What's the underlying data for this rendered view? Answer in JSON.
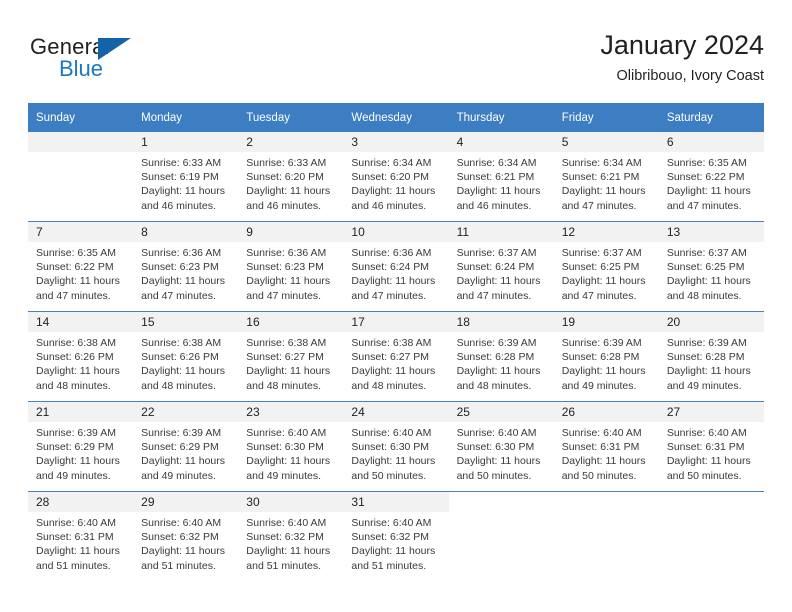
{
  "branding": {
    "name_top": "General",
    "name_bottom": "Blue",
    "triangle_color": "#1263a8",
    "blue_text_color": "#1b79c3"
  },
  "header": {
    "title": "January 2024",
    "subtitle": "Olibribouo, Ivory Coast"
  },
  "theme": {
    "header_row_bg": "#3c7ec1",
    "header_row_text": "#ffffff",
    "daynum_bg": "#f2f2f2",
    "row_divider": "#4a82bd",
    "body_text": "#3a3a3a"
  },
  "calendar": {
    "weekday_headers": [
      "Sunday",
      "Monday",
      "Tuesday",
      "Wednesday",
      "Thursday",
      "Friday",
      "Saturday"
    ],
    "weeks": [
      [
        {
          "day": "",
          "empty": true,
          "banded": true,
          "lines": []
        },
        {
          "day": "1",
          "lines": [
            "Sunrise: 6:33 AM",
            "Sunset: 6:19 PM",
            "Daylight: 11 hours",
            "and 46 minutes."
          ]
        },
        {
          "day": "2",
          "lines": [
            "Sunrise: 6:33 AM",
            "Sunset: 6:20 PM",
            "Daylight: 11 hours",
            "and 46 minutes."
          ]
        },
        {
          "day": "3",
          "lines": [
            "Sunrise: 6:34 AM",
            "Sunset: 6:20 PM",
            "Daylight: 11 hours",
            "and 46 minutes."
          ]
        },
        {
          "day": "4",
          "lines": [
            "Sunrise: 6:34 AM",
            "Sunset: 6:21 PM",
            "Daylight: 11 hours",
            "and 46 minutes."
          ]
        },
        {
          "day": "5",
          "lines": [
            "Sunrise: 6:34 AM",
            "Sunset: 6:21 PM",
            "Daylight: 11 hours",
            "and 47 minutes."
          ]
        },
        {
          "day": "6",
          "lines": [
            "Sunrise: 6:35 AM",
            "Sunset: 6:22 PM",
            "Daylight: 11 hours",
            "and 47 minutes."
          ]
        }
      ],
      [
        {
          "day": "7",
          "lines": [
            "Sunrise: 6:35 AM",
            "Sunset: 6:22 PM",
            "Daylight: 11 hours",
            "and 47 minutes."
          ]
        },
        {
          "day": "8",
          "lines": [
            "Sunrise: 6:36 AM",
            "Sunset: 6:23 PM",
            "Daylight: 11 hours",
            "and 47 minutes."
          ]
        },
        {
          "day": "9",
          "lines": [
            "Sunrise: 6:36 AM",
            "Sunset: 6:23 PM",
            "Daylight: 11 hours",
            "and 47 minutes."
          ]
        },
        {
          "day": "10",
          "lines": [
            "Sunrise: 6:36 AM",
            "Sunset: 6:24 PM",
            "Daylight: 11 hours",
            "and 47 minutes."
          ]
        },
        {
          "day": "11",
          "lines": [
            "Sunrise: 6:37 AM",
            "Sunset: 6:24 PM",
            "Daylight: 11 hours",
            "and 47 minutes."
          ]
        },
        {
          "day": "12",
          "lines": [
            "Sunrise: 6:37 AM",
            "Sunset: 6:25 PM",
            "Daylight: 11 hours",
            "and 47 minutes."
          ]
        },
        {
          "day": "13",
          "lines": [
            "Sunrise: 6:37 AM",
            "Sunset: 6:25 PM",
            "Daylight: 11 hours",
            "and 48 minutes."
          ]
        }
      ],
      [
        {
          "day": "14",
          "lines": [
            "Sunrise: 6:38 AM",
            "Sunset: 6:26 PM",
            "Daylight: 11 hours",
            "and 48 minutes."
          ]
        },
        {
          "day": "15",
          "lines": [
            "Sunrise: 6:38 AM",
            "Sunset: 6:26 PM",
            "Daylight: 11 hours",
            "and 48 minutes."
          ]
        },
        {
          "day": "16",
          "lines": [
            "Sunrise: 6:38 AM",
            "Sunset: 6:27 PM",
            "Daylight: 11 hours",
            "and 48 minutes."
          ]
        },
        {
          "day": "17",
          "lines": [
            "Sunrise: 6:38 AM",
            "Sunset: 6:27 PM",
            "Daylight: 11 hours",
            "and 48 minutes."
          ]
        },
        {
          "day": "18",
          "lines": [
            "Sunrise: 6:39 AM",
            "Sunset: 6:28 PM",
            "Daylight: 11 hours",
            "and 48 minutes."
          ]
        },
        {
          "day": "19",
          "lines": [
            "Sunrise: 6:39 AM",
            "Sunset: 6:28 PM",
            "Daylight: 11 hours",
            "and 49 minutes."
          ]
        },
        {
          "day": "20",
          "lines": [
            "Sunrise: 6:39 AM",
            "Sunset: 6:28 PM",
            "Daylight: 11 hours",
            "and 49 minutes."
          ]
        }
      ],
      [
        {
          "day": "21",
          "lines": [
            "Sunrise: 6:39 AM",
            "Sunset: 6:29 PM",
            "Daylight: 11 hours",
            "and 49 minutes."
          ]
        },
        {
          "day": "22",
          "lines": [
            "Sunrise: 6:39 AM",
            "Sunset: 6:29 PM",
            "Daylight: 11 hours",
            "and 49 minutes."
          ]
        },
        {
          "day": "23",
          "lines": [
            "Sunrise: 6:40 AM",
            "Sunset: 6:30 PM",
            "Daylight: 11 hours",
            "and 49 minutes."
          ]
        },
        {
          "day": "24",
          "lines": [
            "Sunrise: 6:40 AM",
            "Sunset: 6:30 PM",
            "Daylight: 11 hours",
            "and 50 minutes."
          ]
        },
        {
          "day": "25",
          "lines": [
            "Sunrise: 6:40 AM",
            "Sunset: 6:30 PM",
            "Daylight: 11 hours",
            "and 50 minutes."
          ]
        },
        {
          "day": "26",
          "lines": [
            "Sunrise: 6:40 AM",
            "Sunset: 6:31 PM",
            "Daylight: 11 hours",
            "and 50 minutes."
          ]
        },
        {
          "day": "27",
          "lines": [
            "Sunrise: 6:40 AM",
            "Sunset: 6:31 PM",
            "Daylight: 11 hours",
            "and 50 minutes."
          ]
        }
      ],
      [
        {
          "day": "28",
          "lines": [
            "Sunrise: 6:40 AM",
            "Sunset: 6:31 PM",
            "Daylight: 11 hours",
            "and 51 minutes."
          ]
        },
        {
          "day": "29",
          "lines": [
            "Sunrise: 6:40 AM",
            "Sunset: 6:32 PM",
            "Daylight: 11 hours",
            "and 51 minutes."
          ]
        },
        {
          "day": "30",
          "lines": [
            "Sunrise: 6:40 AM",
            "Sunset: 6:32 PM",
            "Daylight: 11 hours",
            "and 51 minutes."
          ]
        },
        {
          "day": "31",
          "lines": [
            "Sunrise: 6:40 AM",
            "Sunset: 6:32 PM",
            "Daylight: 11 hours",
            "and 51 minutes."
          ]
        },
        {
          "day": "",
          "empty": true,
          "banded": false,
          "lines": []
        },
        {
          "day": "",
          "empty": true,
          "banded": false,
          "lines": []
        },
        {
          "day": "",
          "empty": true,
          "banded": false,
          "lines": []
        }
      ]
    ]
  }
}
